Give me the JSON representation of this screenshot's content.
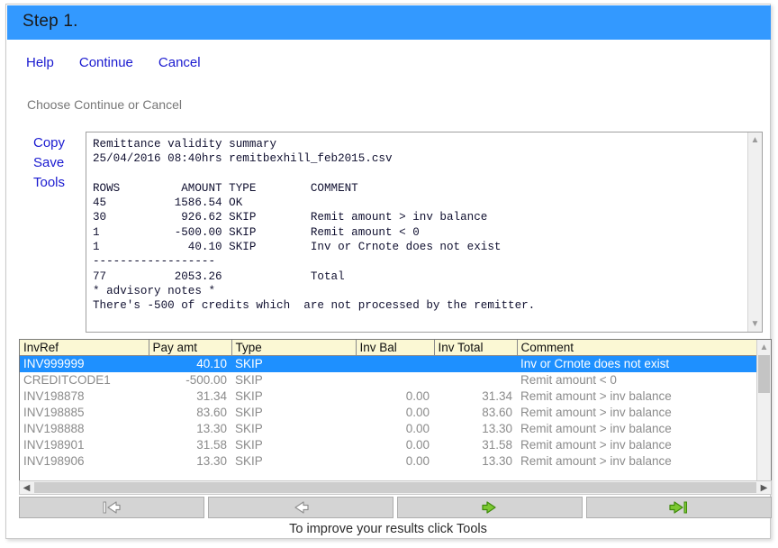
{
  "window": {
    "title": "Step 1."
  },
  "top_links": [
    {
      "label": "Help",
      "name": "help-link"
    },
    {
      "label": "Continue",
      "name": "continue-link"
    },
    {
      "label": "Cancel",
      "name": "cancel-link"
    }
  ],
  "instruction": "Choose Continue or Cancel",
  "side_links": [
    {
      "label": "Copy",
      "name": "copy-link"
    },
    {
      "label": "Save",
      "name": "save-link"
    },
    {
      "label": "Tools",
      "name": "tools-link"
    }
  ],
  "summary": {
    "text": "Remittance validity summary\n25/04/2016 08:40hrs remitbexhill_feb2015.csv\n\nROWS         AMOUNT TYPE        COMMENT\n45          1586.54 OK\n30           926.62 SKIP        Remit amount > inv balance\n1           -500.00 SKIP        Remit amount < 0\n1             40.10 SKIP        Inv or Crnote does not exist\n------------------\n77          2053.26             Total\n* advisory notes *\nThere's -500 of credits which  are not processed by the remitter."
  },
  "grid": {
    "columns": [
      "InvRef",
      "Pay amt",
      "Type",
      "Inv Bal",
      "Inv Total",
      "Comment"
    ],
    "rows": [
      {
        "selected": true,
        "cells": [
          "INV999999",
          "40.10",
          "SKIP",
          "",
          "",
          "Inv or Crnote does not exist"
        ]
      },
      {
        "selected": false,
        "cells": [
          "CREDITCODE1",
          "-500.00",
          "SKIP",
          "",
          "",
          "Remit amount < 0"
        ]
      },
      {
        "selected": false,
        "cells": [
          "INV198878",
          "31.34",
          "SKIP",
          "0.00",
          "31.34",
          "Remit amount > inv balance"
        ]
      },
      {
        "selected": false,
        "cells": [
          "INV198885",
          "83.60",
          "SKIP",
          "0.00",
          "83.60",
          "Remit amount > inv balance"
        ]
      },
      {
        "selected": false,
        "cells": [
          "INV198888",
          "13.30",
          "SKIP",
          "0.00",
          "13.30",
          "Remit amount > inv balance"
        ]
      },
      {
        "selected": false,
        "cells": [
          "INV198901",
          "31.58",
          "SKIP",
          "0.00",
          "31.58",
          "Remit amount > inv balance"
        ]
      },
      {
        "selected": false,
        "cells": [
          "INV198906",
          "13.30",
          "SKIP",
          "0.00",
          "13.30",
          "Remit amount > inv balance"
        ]
      }
    ]
  },
  "nav_buttons": [
    {
      "icon": "first-record-arrow-icon",
      "name": "nav-first-button",
      "enabled": false
    },
    {
      "icon": "previous-record-arrow-icon",
      "name": "nav-previous-button",
      "enabled": false
    },
    {
      "icon": "next-record-arrow-icon",
      "name": "nav-next-button",
      "enabled": true
    },
    {
      "icon": "last-record-arrow-icon",
      "name": "nav-last-button",
      "enabled": true
    }
  ],
  "footer_note": "To improve your results click Tools",
  "colors": {
    "titlebar": "#3399ff",
    "link": "#1a1ad0",
    "header_cell": "#fbf8d4",
    "selection": "#1e90ff",
    "arrow_enabled": "#5caa22",
    "arrow_disabled": "#9a9a9a"
  }
}
